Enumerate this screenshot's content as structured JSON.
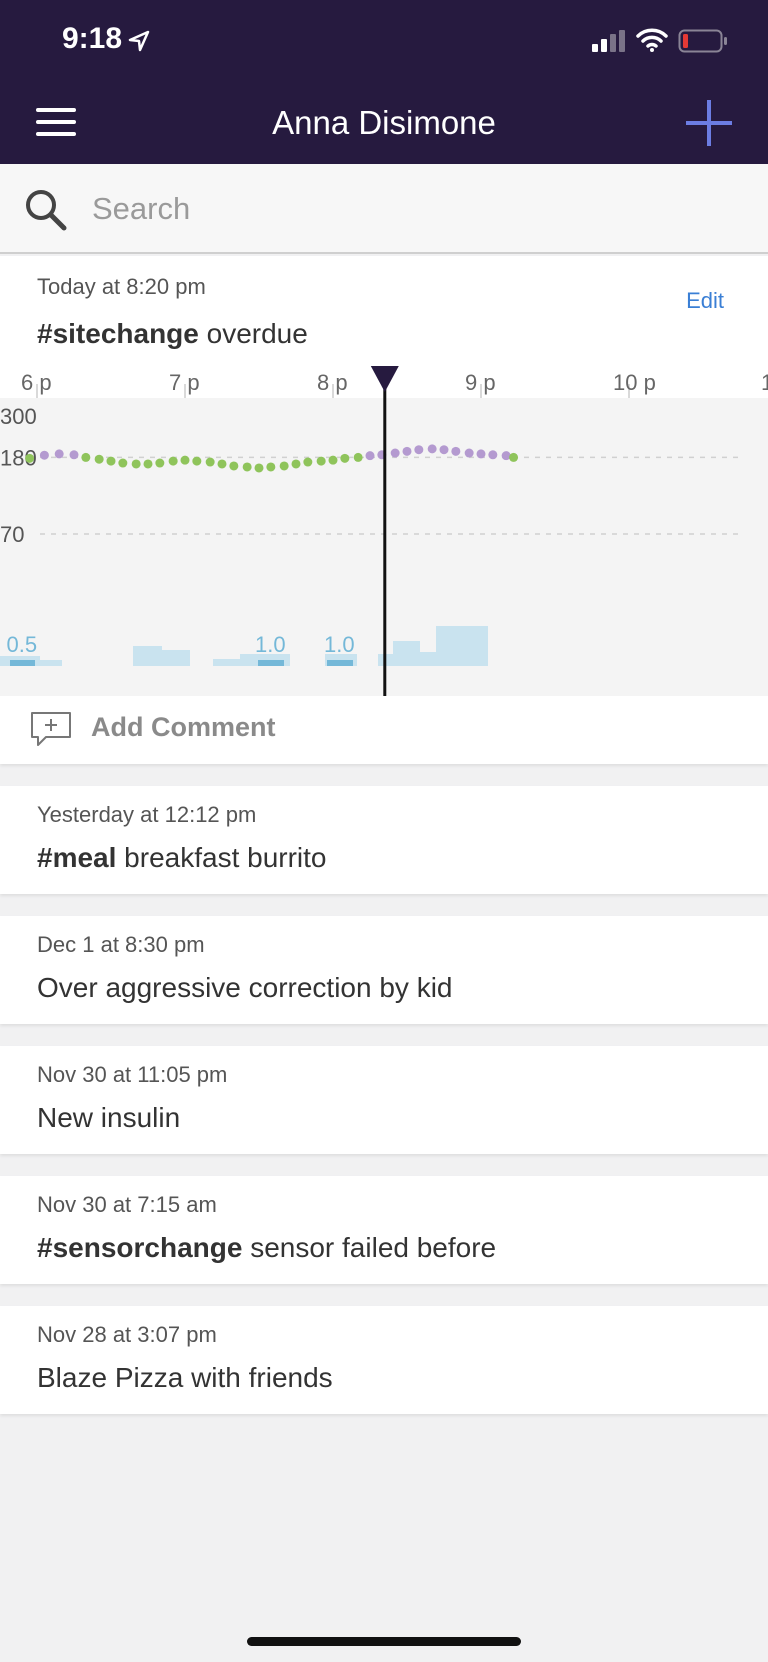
{
  "status": {
    "time": "9:18"
  },
  "nav": {
    "title": "Anna Disimone"
  },
  "search": {
    "placeholder": "Search"
  },
  "first_note": {
    "date": "Today at 8:20 pm",
    "edit_label": "Edit",
    "tag": "#sitechange",
    "text": " overdue",
    "comment_label": "Add Comment"
  },
  "chart_data": {
    "type": "line",
    "x_ticks": [
      "6 p",
      "7 p",
      "8 p",
      "9 p",
      "10 p",
      "1"
    ],
    "y_ticks": [
      "300",
      "180",
      "70"
    ],
    "bolus_labels": [
      "0.5",
      "1.0",
      "1.0"
    ],
    "glucose": {
      "times_hours": [
        5.95,
        6.05,
        6.15,
        6.25,
        6.33,
        6.42,
        6.5,
        6.58,
        6.67,
        6.75,
        6.83,
        6.92,
        7.0,
        7.08,
        7.17,
        7.25,
        7.33,
        7.42,
        7.5,
        7.58,
        7.67,
        7.75,
        7.83,
        7.92,
        8.0,
        8.08,
        8.17,
        8.25,
        8.33,
        8.42,
        8.5,
        8.58,
        8.67,
        8.75,
        8.83,
        8.92,
        9.0,
        9.08,
        9.17,
        9.22
      ],
      "values": [
        178,
        185,
        188,
        186,
        180,
        176,
        172,
        168,
        166,
        166,
        168,
        172,
        174,
        172,
        170,
        166,
        162,
        160,
        158,
        160,
        162,
        166,
        170,
        172,
        174,
        178,
        180,
        184,
        186,
        190,
        194,
        198,
        200,
        198,
        194,
        190,
        188,
        186,
        184,
        180
      ],
      "high_threshold": 180,
      "low_threshold": 70,
      "in_range_color": "#8fc45b",
      "high_color": "#b49ad0"
    },
    "basal_color": "#c9e3ef",
    "bolus_color": "#74b8d8",
    "now_marker_hour": 8.35
  },
  "notes": [
    {
      "date": "Yesterday at 12:12 pm",
      "tag": "#meal",
      "text": " breakfast burrito"
    },
    {
      "date": "Dec 1 at 8:30 pm",
      "tag": "",
      "text": "Over aggressive correction by kid"
    },
    {
      "date": "Nov 30 at 11:05 pm",
      "tag": "",
      "text": "New insulin"
    },
    {
      "date": "Nov 30 at 7:15 am",
      "tag": "#sensorchange",
      "text": " sensor failed before"
    },
    {
      "date": "Nov 28 at 3:07 pm",
      "tag": "",
      "text": "Blaze Pizza with friends"
    }
  ]
}
